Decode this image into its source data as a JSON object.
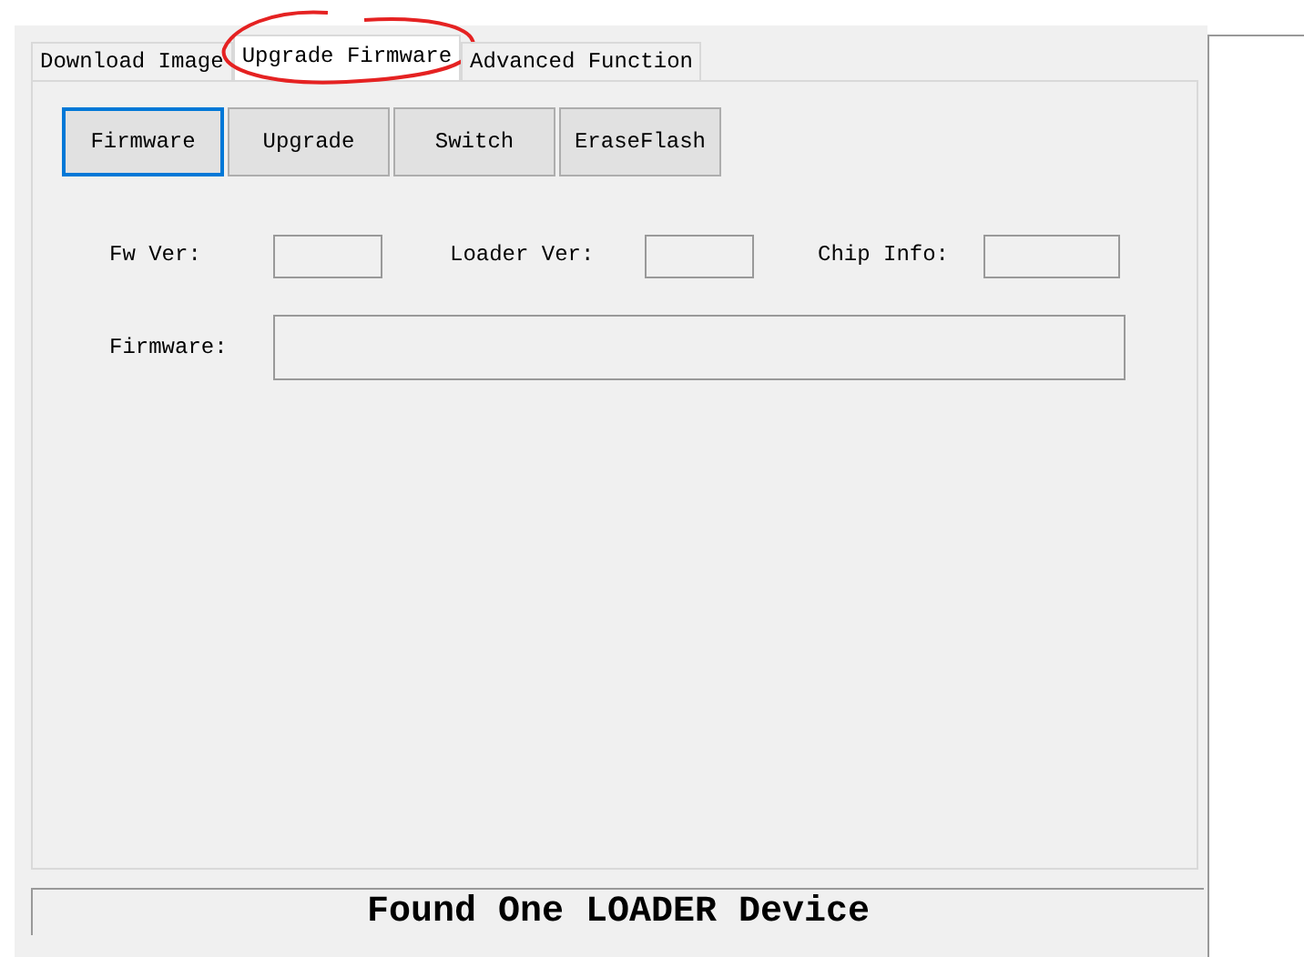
{
  "tabs": [
    {
      "label": "Download Image",
      "selected": false,
      "circled": false
    },
    {
      "label": "Upgrade Firmware",
      "selected": true,
      "circled": true
    },
    {
      "label": "Advanced Function",
      "selected": false,
      "circled": false
    }
  ],
  "buttons": [
    {
      "label": "Firmware",
      "selected": true
    },
    {
      "label": "Upgrade",
      "selected": false
    },
    {
      "label": "Switch",
      "selected": false
    },
    {
      "label": "EraseFlash",
      "selected": false
    }
  ],
  "info_fields": [
    {
      "label": "Fw Ver:"
    },
    {
      "label": "Loader Ver:"
    },
    {
      "label": "Chip Info:"
    }
  ],
  "firmware_field": {
    "label": "Firmware:"
  },
  "status_bar": "Found One LOADER Device"
}
